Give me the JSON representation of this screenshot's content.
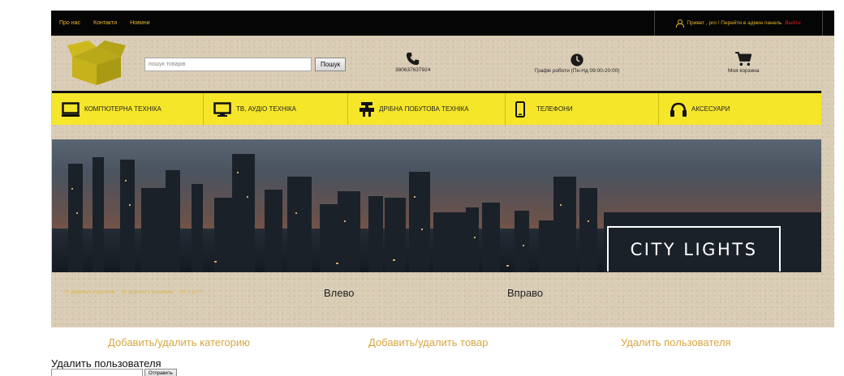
{
  "topbar": {
    "nav": [
      "Про нас",
      "Контакти",
      "Новини"
    ],
    "greeting": "Привет , pro ! Перейти в админ панель",
    "logout": "Выйти"
  },
  "header": {
    "search_placeholder": "пошук товарів",
    "search_button": "Пошук",
    "phone": "380637637924",
    "schedule": "Графік роботи (Пн-Нд 09:00-20:00)",
    "cart": "Моя корзина"
  },
  "categories": [
    {
      "label": "КОМП'ЮТЕРНА ТЕХНІКА",
      "icon": "monitor-icon"
    },
    {
      "label": "ТВ, АУДІО ТЕХНІКА",
      "icon": "tv-icon"
    },
    {
      "label": "ДРІБНА ПОБУТОВА ТЕХНІКА",
      "icon": "appliance-icon"
    },
    {
      "label": "ТЕЛЕФОНИ",
      "icon": "phone-device-icon"
    },
    {
      "label": "АКСЕСУАРИ",
      "icon": "headphones-icon"
    }
  ],
  "banner": {
    "caption": "CITY LIGHTS"
  },
  "sort": [
    "От дешевых к дорогим",
    "От дорогих к дешевым",
    "От А до Я"
  ],
  "slider": {
    "prev": "Влево",
    "next": "Вправо"
  },
  "admin": {
    "links": [
      "Добавить/удалить категорию",
      "Добавить/удалить товар",
      "Удалить пользователя"
    ],
    "form_title": "Удалить пользователя",
    "submit": "Отправить"
  },
  "colors": {
    "accent": "#f5e62a",
    "link": "#d8a640",
    "logout": "#e02020",
    "topbar": "#050505"
  }
}
